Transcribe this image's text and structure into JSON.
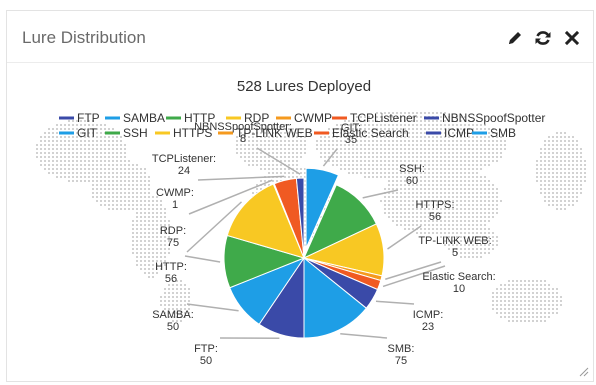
{
  "panel": {
    "title": "Lure Distribution",
    "tools": [
      {
        "name": "edit-icon",
        "label": "edit"
      },
      {
        "name": "refresh-icon",
        "label": "refresh"
      },
      {
        "name": "close-icon",
        "label": "close"
      }
    ]
  },
  "colors": {
    "title_text": "#6a6a6a",
    "map_dots": "#d2d2d2",
    "leader_line": "#b0b0b0"
  },
  "chart_data": {
    "type": "pie",
    "title": "528 Lures Deployed",
    "legend_placement": "top",
    "legend": [
      {
        "label": "FTP",
        "color": "#3a4aa8"
      },
      {
        "label": "SAMBA",
        "color": "#1e9ee6"
      },
      {
        "label": "HTTP",
        "color": "#3faa4a"
      },
      {
        "label": "RDP",
        "color": "#f8c823"
      },
      {
        "label": "CWMP",
        "color": "#f59a1e"
      },
      {
        "label": "TCPListener",
        "color": "#f05a22"
      },
      {
        "label": "NBNSSpoofSpotter",
        "color": "#3a4aa8"
      },
      {
        "label": "GIT",
        "color": "#1e9ee6"
      },
      {
        "label": "SSH",
        "color": "#3faa4a"
      },
      {
        "label": "HTTPS",
        "color": "#f8c823"
      },
      {
        "label": "TP-LINK WEB",
        "color": "#f59a1e"
      },
      {
        "label": "Elastic Search",
        "color": "#f05a22"
      },
      {
        "label": "ICMP",
        "color": "#3a4aa8"
      },
      {
        "label": "SMB",
        "color": "#1e9ee6"
      }
    ],
    "slices": [
      {
        "label": "GIT",
        "value": 35,
        "color": "#1e9ee6",
        "exploded": true
      },
      {
        "label": "SSH",
        "value": 60,
        "color": "#3faa4a"
      },
      {
        "label": "HTTPS",
        "value": 56,
        "color": "#f8c823"
      },
      {
        "label": "TP-LINK WEB",
        "value": 5,
        "color": "#f59a1e"
      },
      {
        "label": "Elastic Search",
        "value": 10,
        "color": "#f05a22"
      },
      {
        "label": "ICMP",
        "value": 23,
        "color": "#3a4aa8"
      },
      {
        "label": "SMB",
        "value": 75,
        "color": "#1e9ee6"
      },
      {
        "label": "FTP",
        "value": 50,
        "color": "#3a4aa8"
      },
      {
        "label": "SAMBA",
        "value": 50,
        "color": "#1e9ee6"
      },
      {
        "label": "HTTP",
        "value": 56,
        "color": "#3faa4a"
      },
      {
        "label": "RDP",
        "value": 75,
        "color": "#f8c823"
      },
      {
        "label": "CWMP",
        "value": 1,
        "color": "#f59a1e"
      },
      {
        "label": "TCPListener",
        "value": 24,
        "color": "#f05a22"
      },
      {
        "label": "NBNSSpoofSpotter",
        "value": 8,
        "color": "#3a4aa8"
      }
    ]
  }
}
